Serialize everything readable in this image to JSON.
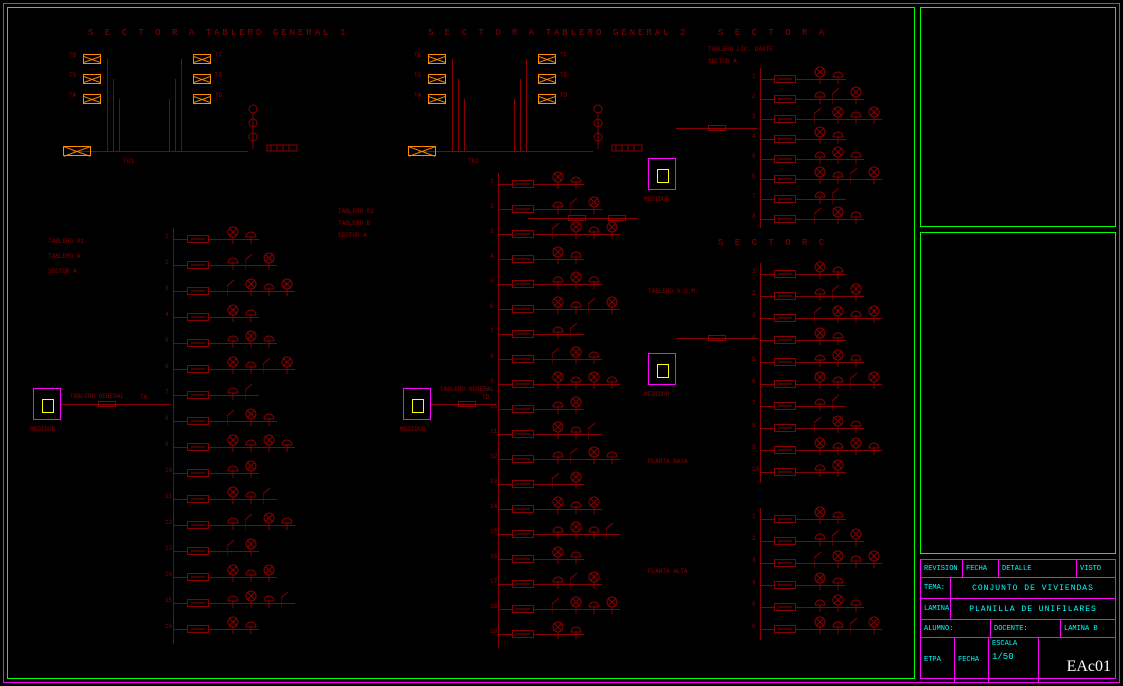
{
  "headers": {
    "tg1": "S E C T O R   A     TABLERO  GENERAL  1",
    "tg2": "S E C T O R   A     TABLERO  GENERAL  2",
    "sec_a": "S E C T O R   A",
    "sec_c": "S E C T O R   C"
  },
  "tg1": {
    "terminals": [
      "TB",
      "TS",
      "TA",
      "TF",
      "TE",
      "TD"
    ],
    "bus_label": "TG1"
  },
  "tg2": {
    "terminals": [
      "TB",
      "TS",
      "TA",
      "TF",
      "TE",
      "TD"
    ],
    "bus_label": "TG2"
  },
  "panels": {
    "t01": {
      "title_lines": [
        "TABLERO 01",
        "TABLERO A",
        "SECTOR A"
      ],
      "meter_label": "MEDIDOR",
      "gen_label": "TABLERO GENERAL",
      "feed": "TA",
      "circuits": 16
    },
    "t02": {
      "title_lines": [
        "TABLERO 02",
        "TABLERO B",
        "SECTOR A"
      ],
      "meter_label": "MEDIDOR",
      "gen_label": "TABLERO GENERAL",
      "feed": "TD",
      "circuits": 19
    },
    "sec_a_right": {
      "title_lines": [
        "TABLERO LIC. DANTE",
        "SECTOR A"
      ],
      "meter_label": "MEDIDOR",
      "circuits": 8
    },
    "sum": {
      "title_lines": [
        "TABLERO S.U.M."
      ],
      "meter_label": "MEDIDOR",
      "circuits": 10,
      "zone_label": "PLANTA BAJA"
    },
    "alta": {
      "zone_label": "PLANTA ALTA",
      "circuits": 6
    }
  },
  "titleblock": {
    "hdr": [
      "REVISION",
      "FECHA",
      "DETALLE",
      "VISTO"
    ],
    "tema_label": "TEMA:",
    "tema": "CONJUNTO DE VIVIENDAS",
    "lamina_label": "LAMINA:",
    "lamina": "PLANILLA DE UNIFILARES",
    "row3": [
      "ALUMNO:",
      "DOCENTE:",
      "LAMINA B"
    ],
    "row4": [
      "ETPA",
      "FECHA",
      "ESCALA"
    ],
    "scale": "1/50",
    "code": "EAc01"
  },
  "colors": {
    "cad_red": "#8b0000",
    "neon": "#00ff00",
    "mag": "#ff00ff",
    "cyan": "#00ffff"
  }
}
